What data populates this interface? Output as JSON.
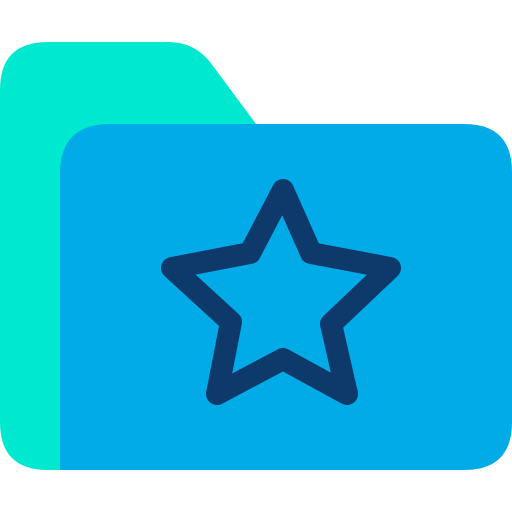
{
  "icon": {
    "name": "starred-folder-icon",
    "colors": {
      "folder_back": "#00E8CF",
      "folder_front": "#00ABE8",
      "star_outline": "#0E3A6B",
      "background": "#FFFFFF"
    }
  }
}
